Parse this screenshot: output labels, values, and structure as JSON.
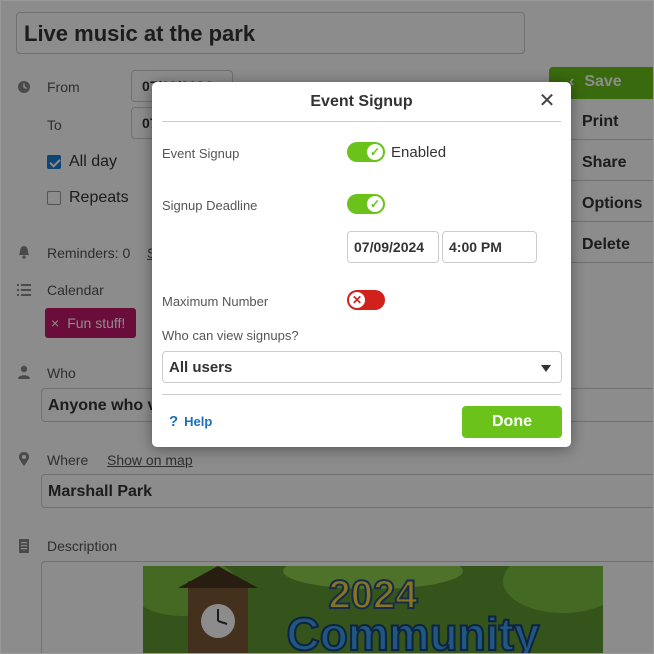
{
  "event": {
    "title": "Live music at the park",
    "from_label": "From",
    "from_value": "07/09/2024",
    "to_label": "To",
    "to_value": "07/09/2024",
    "all_day_label": "All day",
    "repeats_label": "Repeats",
    "reminders_label": "Reminders: 0",
    "reminders_link": "S",
    "calendar_label": "Calendar",
    "calendar_tag_remove": "×",
    "calendar_tag": "Fun stuff!",
    "who_label": "Who",
    "who_value": "Anyone who v",
    "where_label": "Where",
    "show_on_map": "Show on map",
    "where_value": "Marshall Park",
    "description_label": "Description"
  },
  "banner": {
    "year": "2024",
    "word": "Community"
  },
  "actions": {
    "save": "Save",
    "print": "Print",
    "share": "Share",
    "options": "Options",
    "delete": "Delete"
  },
  "modal": {
    "title": "Event Signup",
    "close": "✕",
    "event_signup_label": "Event Signup",
    "enabled_text": "Enabled",
    "signup_deadline_label": "Signup Deadline",
    "deadline_date": "07/09/2024",
    "deadline_time": "4:00 PM",
    "maximum_number_label": "Maximum Number",
    "who_can_view_label": "Who can view signups?",
    "who_can_view_value": "All users",
    "help_icon": "?",
    "help_label": "Help",
    "done_label": "Done"
  },
  "colors": {
    "accent_green": "#6ac21a",
    "toggle_off_red": "#d0211c",
    "tag_magenta": "#c2186b",
    "link_blue": "#1c6fb8"
  }
}
